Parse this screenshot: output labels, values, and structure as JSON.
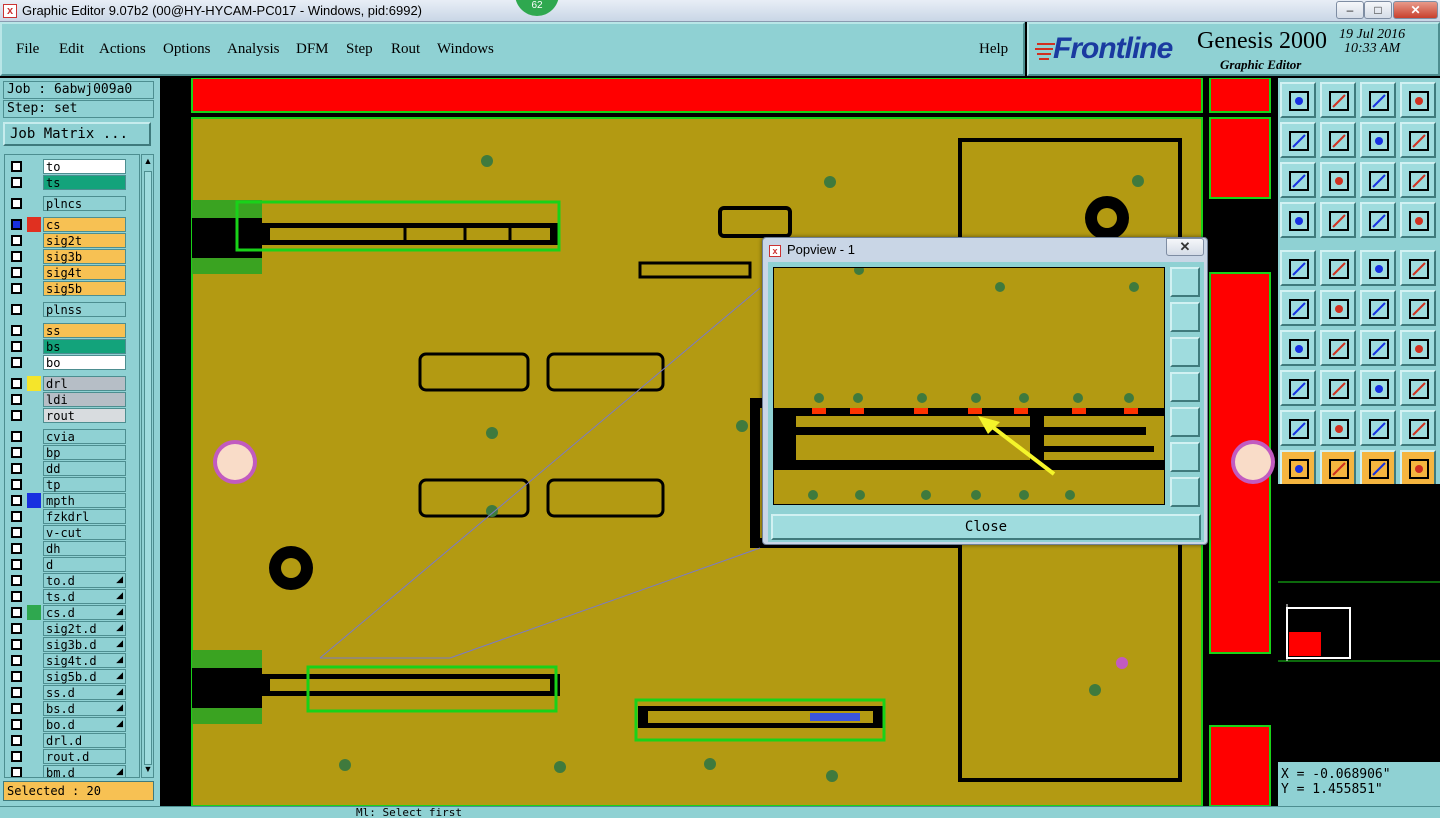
{
  "window": {
    "title": "Graphic Editor 9.07b2 (00@HY-HYCAM-PC017 - Windows, pid:6992)",
    "badge": "62",
    "minimize_label": "–",
    "maximize_label": "□",
    "close_label": "✕"
  },
  "menu": {
    "items": [
      "File",
      "Edit",
      "Actions",
      "Options",
      "Analysis",
      "DFM",
      "Step",
      "Rout",
      "Windows"
    ],
    "help": "Help"
  },
  "brand": {
    "logo": "Frontline",
    "product": "Genesis 2000",
    "subtitle": "Graphic Editor",
    "date": "19 Jul 2016",
    "time": "10:33 AM"
  },
  "job": {
    "job_label": "Job : 6abwj009a0",
    "step_label": "Step: set",
    "matrix_button": "Job Matrix ..."
  },
  "layers": [
    {
      "name": "to",
      "color": "#ffffff"
    },
    {
      "name": "ts",
      "color": "#13a37b"
    },
    {
      "name": "plncs",
      "color": "#8fd1d3"
    },
    {
      "name": "cs",
      "color": "#f7c153",
      "active": true
    },
    {
      "name": "sig2t",
      "color": "#f7c153"
    },
    {
      "name": "sig3b",
      "color": "#f7c153"
    },
    {
      "name": "sig4t",
      "color": "#f7c153"
    },
    {
      "name": "sig5b",
      "color": "#f7c153"
    },
    {
      "name": "plnss",
      "color": "#8fd1d3"
    },
    {
      "name": "ss",
      "color": "#f7c153"
    },
    {
      "name": "bs",
      "color": "#13a37b"
    },
    {
      "name": "bo",
      "color": "#ffffff"
    },
    {
      "name": "drl",
      "color": "#b6bec6",
      "swatch": "#f5e52a"
    },
    {
      "name": "ldi",
      "color": "#b6bec6"
    },
    {
      "name": "rout",
      "color": "#d8dcdf"
    },
    {
      "name": "cvia",
      "color": "#8fd1d3"
    },
    {
      "name": "bp",
      "color": "#8fd1d3"
    },
    {
      "name": "dd",
      "color": "#8fd1d3"
    },
    {
      "name": "tp",
      "color": "#8fd1d3"
    },
    {
      "name": "mpth",
      "color": "#8fd1d3",
      "swatch": "#1830e0"
    },
    {
      "name": "fzkdrl",
      "color": "#8fd1d3"
    },
    {
      "name": "v-cut",
      "color": "#8fd1d3"
    },
    {
      "name": "dh",
      "color": "#8fd1d3"
    },
    {
      "name": "d",
      "color": "#8fd1d3"
    },
    {
      "name": "to.d",
      "color": "#8fd1d3",
      "sub": true
    },
    {
      "name": "ts.d",
      "color": "#8fd1d3",
      "sub": true
    },
    {
      "name": "cs.d",
      "color": "#8fd1d3",
      "sub": true,
      "swatch": "#2fa84f"
    },
    {
      "name": "sig2t.d",
      "color": "#8fd1d3",
      "sub": true
    },
    {
      "name": "sig3b.d",
      "color": "#8fd1d3",
      "sub": true
    },
    {
      "name": "sig4t.d",
      "color": "#8fd1d3",
      "sub": true
    },
    {
      "name": "sig5b.d",
      "color": "#8fd1d3",
      "sub": true
    },
    {
      "name": "ss.d",
      "color": "#8fd1d3",
      "sub": true
    },
    {
      "name": "bs.d",
      "color": "#8fd1d3",
      "sub": true
    },
    {
      "name": "bo.d",
      "color": "#8fd1d3",
      "sub": true
    },
    {
      "name": "drl.d",
      "color": "#8fd1d3"
    },
    {
      "name": "rout.d",
      "color": "#8fd1d3"
    },
    {
      "name": "bm.d",
      "color": "#8fd1d3",
      "sub": true
    }
  ],
  "selected": "Selected : 20",
  "popview": {
    "title": "Popview - 1",
    "close_button": "Close",
    "close_x": "✕"
  },
  "coords": {
    "x": "X = -0.068906\"",
    "y": "Y = 1.455851\""
  },
  "status_hint": "Ml:  Select first",
  "colors": {
    "panel": "#8fd1d3",
    "board": "#b39a12",
    "copper_red": "#ff0000",
    "highlight": "#19d219"
  },
  "toolbar_icons": [
    "zoom-home-icon",
    "zoom-back-icon",
    "home-view-icon",
    "split-view-icon",
    "pan-left-icon",
    "pan-right-icon",
    "swap-icon",
    "rotate-icon",
    "fit-all-icon",
    "fit-selection-icon",
    "ratio-icon",
    "help-icon",
    "measure-icon",
    "snap-icon",
    "layer-a-icon",
    "layer-b-icon",
    "select-pad-icon",
    "color-icon",
    "ruler-icon",
    "dot-icon",
    "connect-icon",
    "cross-icon",
    "line-a-icon",
    "line-b-icon",
    "angle-icon",
    "slope-icon",
    "arc-icon",
    "flip-icon",
    "feature-a-icon",
    "feature-b-icon",
    "center-icon",
    "group-icon",
    "tri-a-icon",
    "tri-b-icon",
    "arc-a-icon",
    "arc-b-icon",
    "pointer-icon",
    "pointer-box-icon",
    "pointer-circle-icon",
    "pointer-tree-icon"
  ]
}
